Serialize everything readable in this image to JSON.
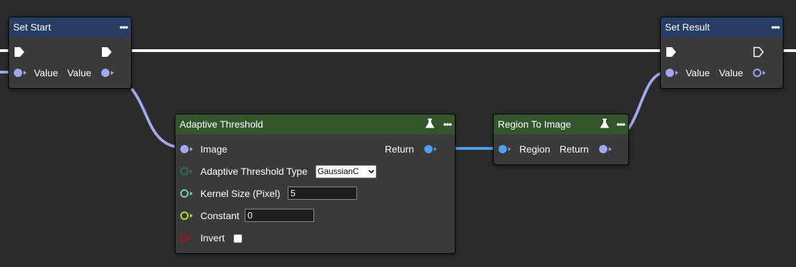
{
  "nodes": {
    "set_start": {
      "title": "Set Start",
      "input_label": "Value",
      "output_label": "Value",
      "menu": "•••"
    },
    "set_result": {
      "title": "Set Result",
      "input_label": "Value",
      "output_label": "Value",
      "menu": "•••"
    },
    "adaptive_threshold": {
      "title": "Adaptive Threshold",
      "menu": "•••",
      "image_label": "Image",
      "return_label": "Return",
      "type_label": "Adaptive Threshold Type",
      "type_value": "GaussianC",
      "kernel_label": "Kernel Size (Pixel)",
      "kernel_value": "5",
      "constant_label": "Constant",
      "constant_value": "0",
      "invert_label": "Invert",
      "invert_checked": false
    },
    "region_to_image": {
      "title": "Region To Image",
      "menu": "•••",
      "region_label": "Region",
      "return_label": "Return"
    }
  },
  "colors": {
    "canvas": "#2b2b2b",
    "node_body": "#3a3a3a",
    "header_blue": "#273d64",
    "header_green": "#33552b",
    "pin_value": "#a0a8f0",
    "pin_region": "#4ea0e8",
    "pin_type": "#2e6f5f",
    "pin_kernel": "#6fd8b0",
    "pin_constant": "#b8e040",
    "pin_invert": "#a01818",
    "exec_wire": "#ffffff"
  },
  "icons": {
    "flask": "flask-icon",
    "exec": "exec-pin-icon",
    "menu": "more-icon"
  }
}
